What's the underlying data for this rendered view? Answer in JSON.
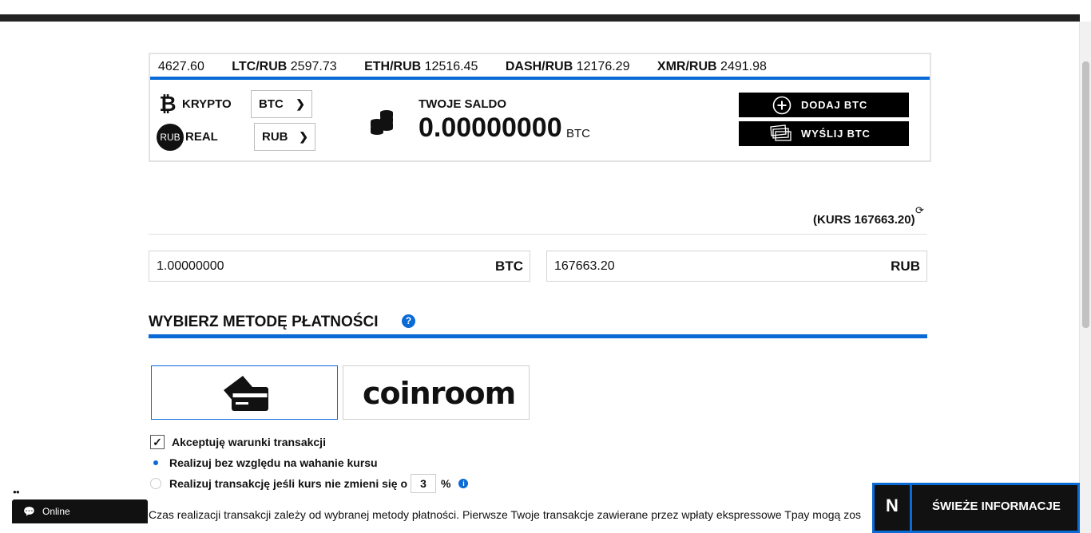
{
  "ticker": [
    {
      "pair": "",
      "value": "4627.60"
    },
    {
      "pair": "LTC/RUB",
      "value": "2597.73"
    },
    {
      "pair": "ETH/RUB",
      "value": "12516.45"
    },
    {
      "pair": "DASH/RUB",
      "value": "12176.29"
    },
    {
      "pair": "XMR/RUB",
      "value": "2491.98"
    }
  ],
  "selectors": {
    "crypto_label": "KRYPTO",
    "crypto_value": "BTC",
    "real_label": "REAL",
    "real_icon_text": "RUB",
    "real_value": "RUB"
  },
  "balance": {
    "label": "TWOJE SALDO",
    "value": "0.00000000",
    "unit": "BTC"
  },
  "actions": {
    "add": "DODAJ BTC",
    "send": "WYŚLIJ BTC"
  },
  "rate": {
    "text": "(KURS 167663.20)"
  },
  "amounts": {
    "crypto_value": "1.00000000",
    "crypto_unit": "BTC",
    "fiat_value": "167663.20",
    "fiat_unit": "RUB"
  },
  "payment": {
    "title": "WYBIERZ METODĘ PŁATNOŚCI",
    "help_icon": "?",
    "coinroom_logo": "coinroom"
  },
  "options": {
    "accept_terms": "Akceptuję warunki transakcji",
    "accept_checked": "✓",
    "regardless": "Realizuj bez względu na wahanie kursu",
    "if_rate": "Realizuj transakcję jeśli kurs nie zmieni się o",
    "percent_value": "3",
    "percent_sign": "%",
    "info_icon": "i"
  },
  "footnote": "Czas realizacji transakcji zależy od wybranej metody płatności. Pierwsze Twoje transakcje zawierane przez wpłaty ekspressowe Tpay mogą zos",
  "chat": {
    "status": "Online"
  },
  "news": {
    "logo": "N",
    "label": "ŚWIEŻE INFORMACJE"
  },
  "colors": {
    "accent": "#0a6ad6",
    "dark": "#111111"
  }
}
